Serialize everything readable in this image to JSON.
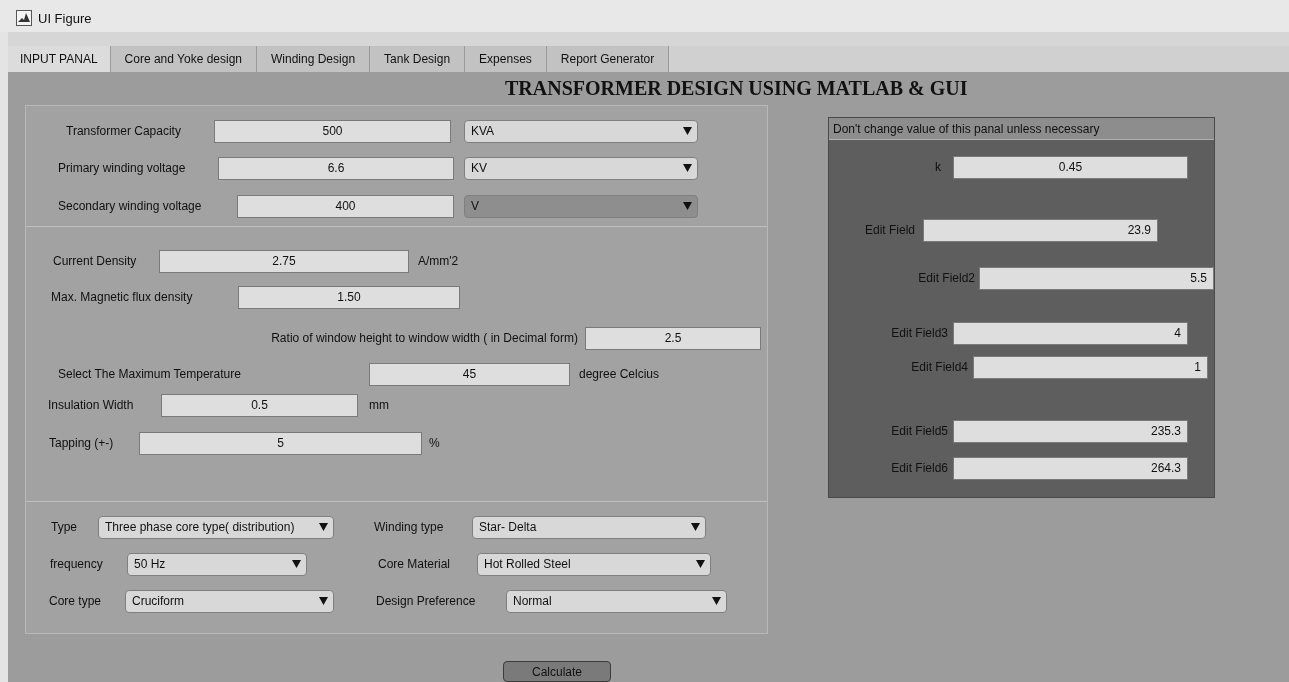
{
  "window": {
    "title": "UI Figure"
  },
  "tabs": [
    {
      "label": "INPUT PANAL",
      "selected": true
    },
    {
      "label": "Core and Yoke design",
      "selected": false
    },
    {
      "label": "Winding Design",
      "selected": false
    },
    {
      "label": "Tank Design",
      "selected": false
    },
    {
      "label": "Expenses",
      "selected": false
    },
    {
      "label": "Report Generator",
      "selected": false
    }
  ],
  "heading": "TRANSFORMER DESIGN USING MATLAB & GUI",
  "ratings": [
    {
      "label": "Transformer Capacity",
      "value": "500",
      "unit": "KVA",
      "highlighted": false
    },
    {
      "label": "Primary winding voltage",
      "value": "6.6",
      "unit": "KV",
      "highlighted": false
    },
    {
      "label": "Secondary winding voltage",
      "value": "400",
      "unit": "V",
      "highlighted": true
    }
  ],
  "parameters": [
    {
      "label": "Current Density",
      "value": "2.75",
      "unit": "A/mm'2"
    },
    {
      "label": "Max. Magnetic flux density",
      "value": "1.50"
    },
    {
      "label": "Ratio of window height to window width ( in Decimal form)",
      "value": "2.5"
    },
    {
      "label": "Select The Maximum Temperature",
      "value": "45",
      "unit": "degree Celcius"
    },
    {
      "label": "Insulation Width",
      "value": "0.5",
      "unit": "mm"
    },
    {
      "label": "Tapping (+-)",
      "value": "5",
      "unit": "%"
    }
  ],
  "options": [
    {
      "label": "Type",
      "value": "Three phase core type( distribution)"
    },
    {
      "label": "Winding type",
      "value": "Star- Delta"
    },
    {
      "label": "frequency",
      "value": "50 Hz"
    },
    {
      "label": "Core Material",
      "value": "Hot Rolled Steel"
    },
    {
      "label": "Core type",
      "value": "Cruciform"
    },
    {
      "label": "Design Preference",
      "value": "Normal"
    }
  ],
  "constants": {
    "title": "Don't change value of this panal unless necessary",
    "fields": [
      {
        "label": "k",
        "value": "0.45",
        "kind": "centered"
      },
      {
        "label": "Edit Field",
        "value": "23.9",
        "kind": "right"
      },
      {
        "label": "Edit Field2",
        "value": "5.5",
        "kind": "right"
      },
      {
        "label": "Edit Field3",
        "value": "4",
        "kind": "right"
      },
      {
        "label": "Edit Field4",
        "value": "1",
        "kind": "right"
      },
      {
        "label": "Edit Field5",
        "value": "235.3",
        "kind": "right"
      },
      {
        "label": "Edit Field6",
        "value": "264.3",
        "kind": "right"
      }
    ]
  },
  "calculate_button": "Calculate"
}
